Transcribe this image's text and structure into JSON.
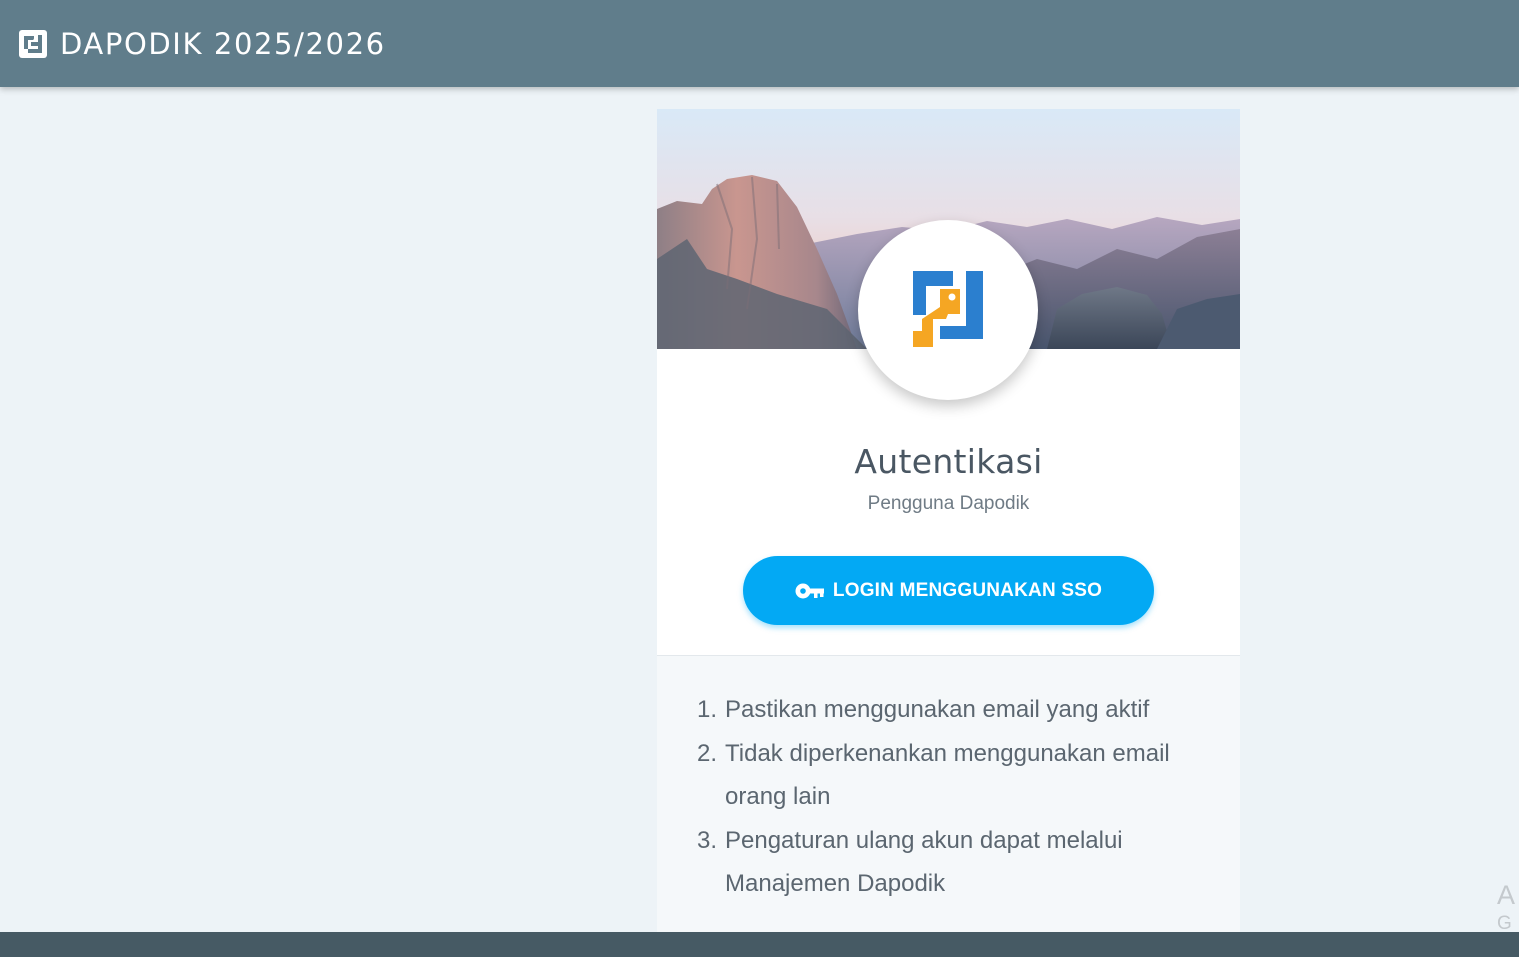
{
  "header": {
    "title": "DAPODIK 2025/2026",
    "logo_icon": "dapodik-logo-icon"
  },
  "card": {
    "hero_image": "mountain-landscape-image",
    "title": "Autentikasi",
    "subtitle": "Pengguna Dapodik",
    "login_button": {
      "label": "LOGIN MENGGUNAKAN SSO",
      "icon": "key-icon"
    },
    "notes": [
      {
        "num": "1.",
        "text": "Pastikan menggunakan email yang aktif"
      },
      {
        "num": "2.",
        "text": "Tidak diperkenankan menggunakan email orang lain"
      },
      {
        "num": "3.",
        "text": "Pengaturan ulang akun dapat melalui Manajemen Dapodik"
      }
    ]
  },
  "watermark": {
    "line1": "A",
    "line2": "G"
  },
  "colors": {
    "topbar": "#607d8b",
    "page_background": "#edf3f7",
    "button": "#03a9f4",
    "logo_blue": "#2b7fcf",
    "logo_orange": "#f5a623",
    "bottombar": "#465a64"
  }
}
